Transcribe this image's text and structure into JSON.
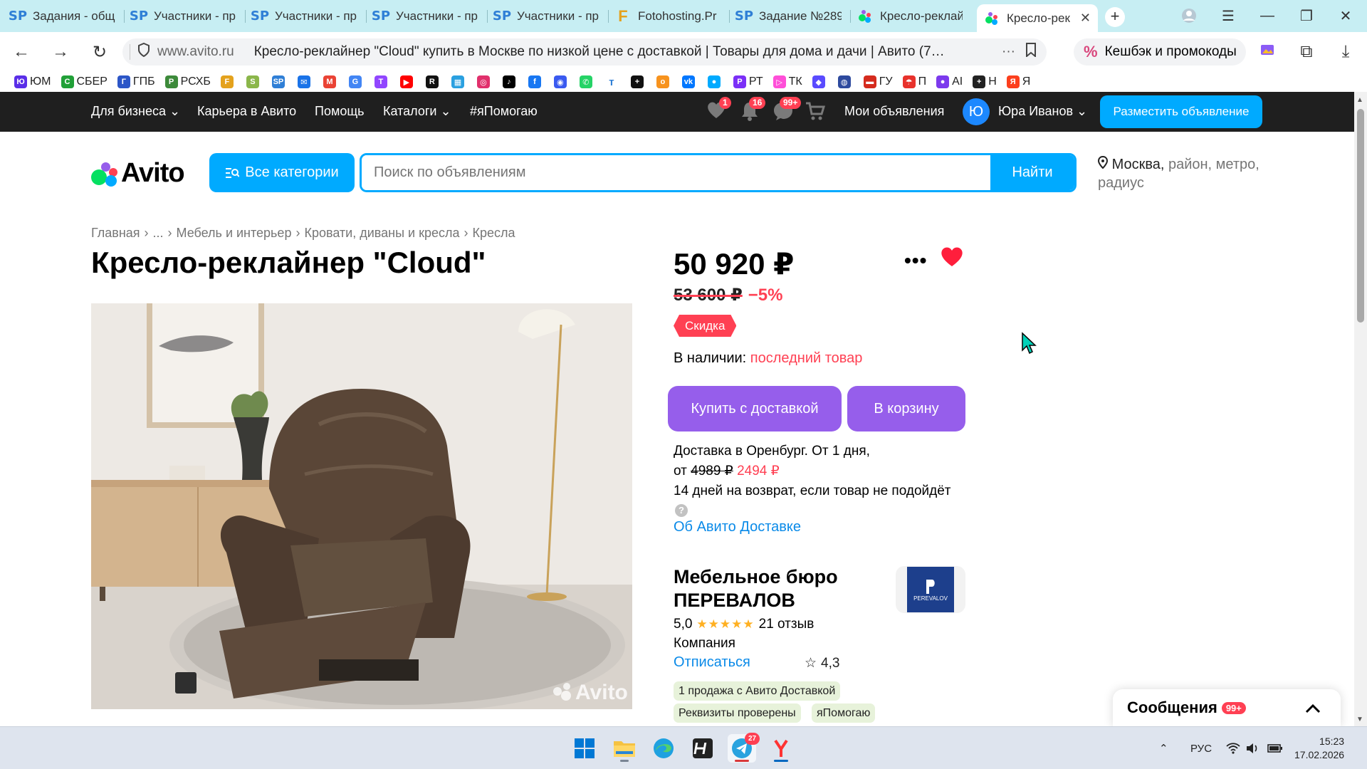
{
  "browser": {
    "tabs": [
      {
        "label": "Задания - общ",
        "icon": "sp"
      },
      {
        "label": "Участники - пр",
        "icon": "sp"
      },
      {
        "label": "Участники - пр",
        "icon": "sp"
      },
      {
        "label": "Участники - пр",
        "icon": "sp"
      },
      {
        "label": "Участники - пр",
        "icon": "sp"
      },
      {
        "label": "Fotohosting.Pr",
        "icon": "f"
      },
      {
        "label": "Задание №289",
        "icon": "sp"
      },
      {
        "label": "Кресло-реклай",
        "icon": "avito"
      },
      {
        "label": "Кресло-рек",
        "icon": "avito",
        "active": true
      }
    ],
    "sp_glyph": "SP",
    "f_glyph": "F",
    "rating": "4,3",
    "domain": "www.avito.ru",
    "page_title": "Кресло-реклайнер \"Cloud\" купить в Москве по низкой цене с доставкой | Товары для дома и дачи | Авито (7…",
    "cashback": "Кешбэк и промокоды",
    "bookmarks": [
      {
        "label": "ЮМ",
        "color": "#5a2ee8",
        "glyph": "Ю"
      },
      {
        "label": "СБЕР",
        "color": "#21a038",
        "glyph": "С"
      },
      {
        "label": "ГПБ",
        "color": "#2c56c7",
        "glyph": "Г"
      },
      {
        "label": "РСХБ",
        "color": "#3d8a3a",
        "glyph": "Р"
      },
      {
        "label": "",
        "color": "#e4a21d",
        "glyph": "F"
      },
      {
        "label": "",
        "color": "#8bb64a",
        "glyph": "S"
      },
      {
        "label": "",
        "color": "#2f7fd6",
        "glyph": "SP"
      },
      {
        "label": "",
        "color": "#1a73e8",
        "glyph": "✉"
      },
      {
        "label": "",
        "color": "#ea4335",
        "glyph": "M"
      },
      {
        "label": "",
        "color": "#4285f4",
        "glyph": "G"
      },
      {
        "label": "",
        "color": "#9146ff",
        "glyph": "T"
      },
      {
        "label": "",
        "color": "#ff0000",
        "glyph": "▶"
      },
      {
        "label": "",
        "color": "#111111",
        "glyph": "R"
      },
      {
        "label": "",
        "color": "#2aa0e0",
        "glyph": "▦"
      },
      {
        "label": "",
        "color": "#e1306c",
        "glyph": "◎"
      },
      {
        "label": "",
        "color": "#000000",
        "glyph": "♪"
      },
      {
        "label": "",
        "color": "#1877f2",
        "glyph": "f"
      },
      {
        "label": "",
        "color": "#3a5af0",
        "glyph": "◉"
      },
      {
        "label": "",
        "color": "#25d366",
        "glyph": "✆"
      },
      {
        "label": "",
        "color": "#ffffff",
        "glyph": "т"
      },
      {
        "label": "",
        "color": "#111111",
        "glyph": "+"
      },
      {
        "label": "",
        "color": "#f7931e",
        "glyph": "о"
      },
      {
        "label": "",
        "color": "#0077ff",
        "glyph": "vk"
      },
      {
        "label": "",
        "color": "#00aaff",
        "glyph": "●"
      },
      {
        "label": "РТ",
        "color": "#7b2ff7",
        "glyph": "Р"
      },
      {
        "label": "ТК",
        "color": "#ff4fd8",
        "glyph": "▷"
      },
      {
        "label": "",
        "color": "#5a4bff",
        "glyph": "◆"
      },
      {
        "label": "",
        "color": "#2e4a9e",
        "glyph": "◍"
      },
      {
        "label": "ГУ",
        "color": "#d52b1e",
        "glyph": "▬"
      },
      {
        "label": "П",
        "color": "#e8322c",
        "glyph": "☂"
      },
      {
        "label": "AI",
        "color": "#7c3aed",
        "glyph": "●"
      },
      {
        "label": "Н",
        "color": "#222222",
        "glyph": "+"
      },
      {
        "label": "Я",
        "color": "#fc3f1d",
        "glyph": "Я"
      }
    ]
  },
  "avito_header": {
    "links": [
      "Для бизнеса",
      "Карьера в Авито",
      "Помощь",
      "Каталоги",
      "#яПомогаю"
    ],
    "favorites_badge": "1",
    "notifications_badge": "16",
    "messages_badge": "99+",
    "my_ads": "Мои объявления",
    "avatar_letter": "Ю",
    "user_name": "Юра Иванов",
    "post_button": "Разместить объявление"
  },
  "search": {
    "logo_text": "Avito",
    "categories_button": "Все категории",
    "placeholder": "Поиск по объявлениям",
    "find_button": "Найти",
    "location_city": "Москва,",
    "location_rest": " район, метро, радиус"
  },
  "breadcrumbs": [
    "Главная",
    "...",
    "Мебель и интерьер",
    "Кровати, диваны и кресла",
    "Кресла"
  ],
  "breadcrumb_sep": "›",
  "product": {
    "title": "Кресло-реклайнер \"Cloud\"",
    "price": "50 920 ₽",
    "old_price": "53 600 ₽",
    "discount": "−5%",
    "sale_tag": "Скидка",
    "stock_label": "В наличии:",
    "stock_value": "последний товар",
    "buy_button": "Купить с доставкой",
    "cart_button": "В корзину",
    "delivery_line1": "Доставка в Оренбург. От 1 дня,",
    "delivery_from": "от",
    "delivery_old": "4989 ₽",
    "delivery_new": "2494 ₽",
    "return_text": "14 дней на возврат, если товар не подойдёт",
    "about_link": "Об Авито Доставке",
    "photo_watermark": "Avito"
  },
  "seller": {
    "name": "Мебельное бюро ПЕРЕВАЛОВ",
    "logo_text": "PEREVALOV",
    "rating": "5,0",
    "stars": "★★★★★",
    "reviews": "21 отзыв",
    "type": "Компания",
    "unsubscribe": "Отписаться",
    "chips": [
      "1 продажа с Авито Доставкой",
      "Реквизиты проверены",
      "яПомогаю"
    ]
  },
  "messages_panel": {
    "label": "Сообщения",
    "badge": "99+"
  },
  "taskbar": {
    "telegram_badge": "27",
    "lang": "РУС",
    "time": "15:23",
    "date": "17.02.2026"
  }
}
